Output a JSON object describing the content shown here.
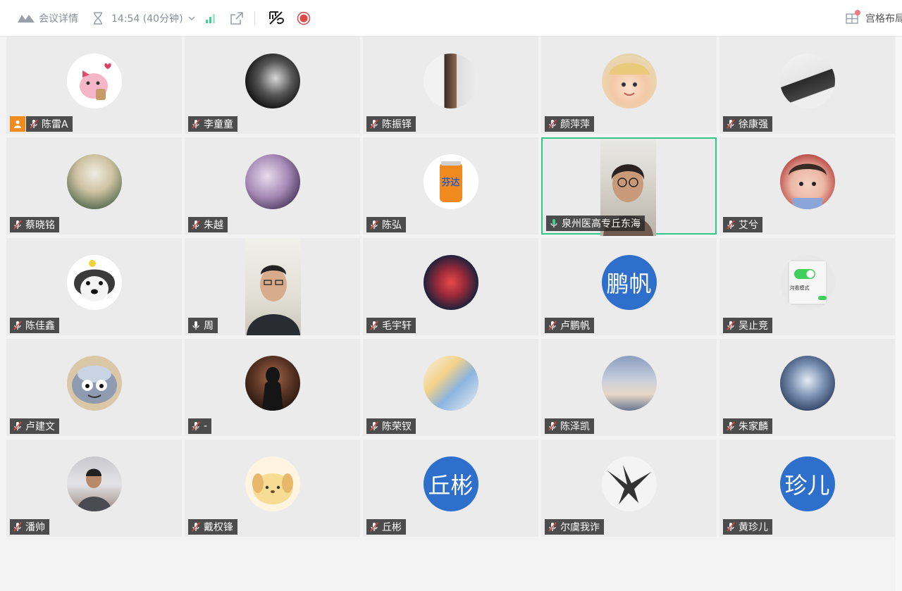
{
  "toolbar": {
    "meeting_details": "会议详情",
    "time": "14:54 (40分钟)",
    "layout": "宫格布局"
  },
  "colors": {
    "active_border": "#2fc78b",
    "host_badge": "#f08a1c",
    "text_avatar_bg": "#2f6fcc"
  },
  "participants": [
    {
      "name": "陈雷A",
      "host": true,
      "mic": "muted",
      "avatar": "pink-cartoon-avatar"
    },
    {
      "name": "李童童",
      "mic": "muted",
      "avatar": "ink-portrait-avatar"
    },
    {
      "name": "陈振铎",
      "mic": "muted",
      "avatar": "anime-boy-avatar"
    },
    {
      "name": "颜萍萍",
      "mic": "muted",
      "avatar": "child-photo-avatar"
    },
    {
      "name": "徐康强",
      "mic": "muted",
      "avatar": "anime-sketch-avatar"
    },
    {
      "name": "蔡晓铭",
      "mic": "muted",
      "avatar": "anime-cat-avatar"
    },
    {
      "name": "朱越",
      "mic": "muted",
      "avatar": "anime-purple-avatar"
    },
    {
      "name": "陈弘",
      "mic": "muted",
      "avatar": "soda-can-avatar",
      "can_text": "芬达"
    },
    {
      "name": "泉州医高专丘东海",
      "mic": "on",
      "active": true,
      "video": true
    },
    {
      "name": "艾兮",
      "mic": "muted",
      "avatar": "baby-photo-avatar"
    },
    {
      "name": "陈佳鑫",
      "mic": "muted",
      "avatar": "dog-avatar"
    },
    {
      "name": "周",
      "mic": "on",
      "video": true
    },
    {
      "name": "毛宇轩",
      "mic": "muted",
      "avatar": "anime-girl-avatar"
    },
    {
      "name": "卢鹏帆",
      "mic": "muted",
      "text_avatar": "鹏帆"
    },
    {
      "name": "吴止竞",
      "mic": "muted",
      "avatar": "toggle-switch-avatar",
      "avatar_caption": "沟看模式"
    },
    {
      "name": "卢建文",
      "mic": "muted",
      "avatar": "monster-avatar"
    },
    {
      "name": "-",
      "mic": "muted",
      "avatar": "dark-figure-avatar"
    },
    {
      "name": "陈荣钗",
      "mic": "muted",
      "avatar": "illustration-avatar"
    },
    {
      "name": "陈泽凯",
      "mic": "muted",
      "avatar": "sky-avatar"
    },
    {
      "name": "朱家麟",
      "mic": "muted",
      "avatar": "anime-blue-avatar"
    },
    {
      "name": "潘帅",
      "mic": "muted",
      "avatar": "man-photo-avatar"
    },
    {
      "name": "戴权锋",
      "mic": "muted",
      "avatar": "pompompurin-avatar"
    },
    {
      "name": "丘彬",
      "mic": "muted",
      "text_avatar": "丘彬"
    },
    {
      "name": "尔虞我诈",
      "mic": "muted",
      "avatar": "eagle-avatar"
    },
    {
      "name": "黄珍儿",
      "mic": "muted",
      "text_avatar": "珍儿"
    }
  ]
}
